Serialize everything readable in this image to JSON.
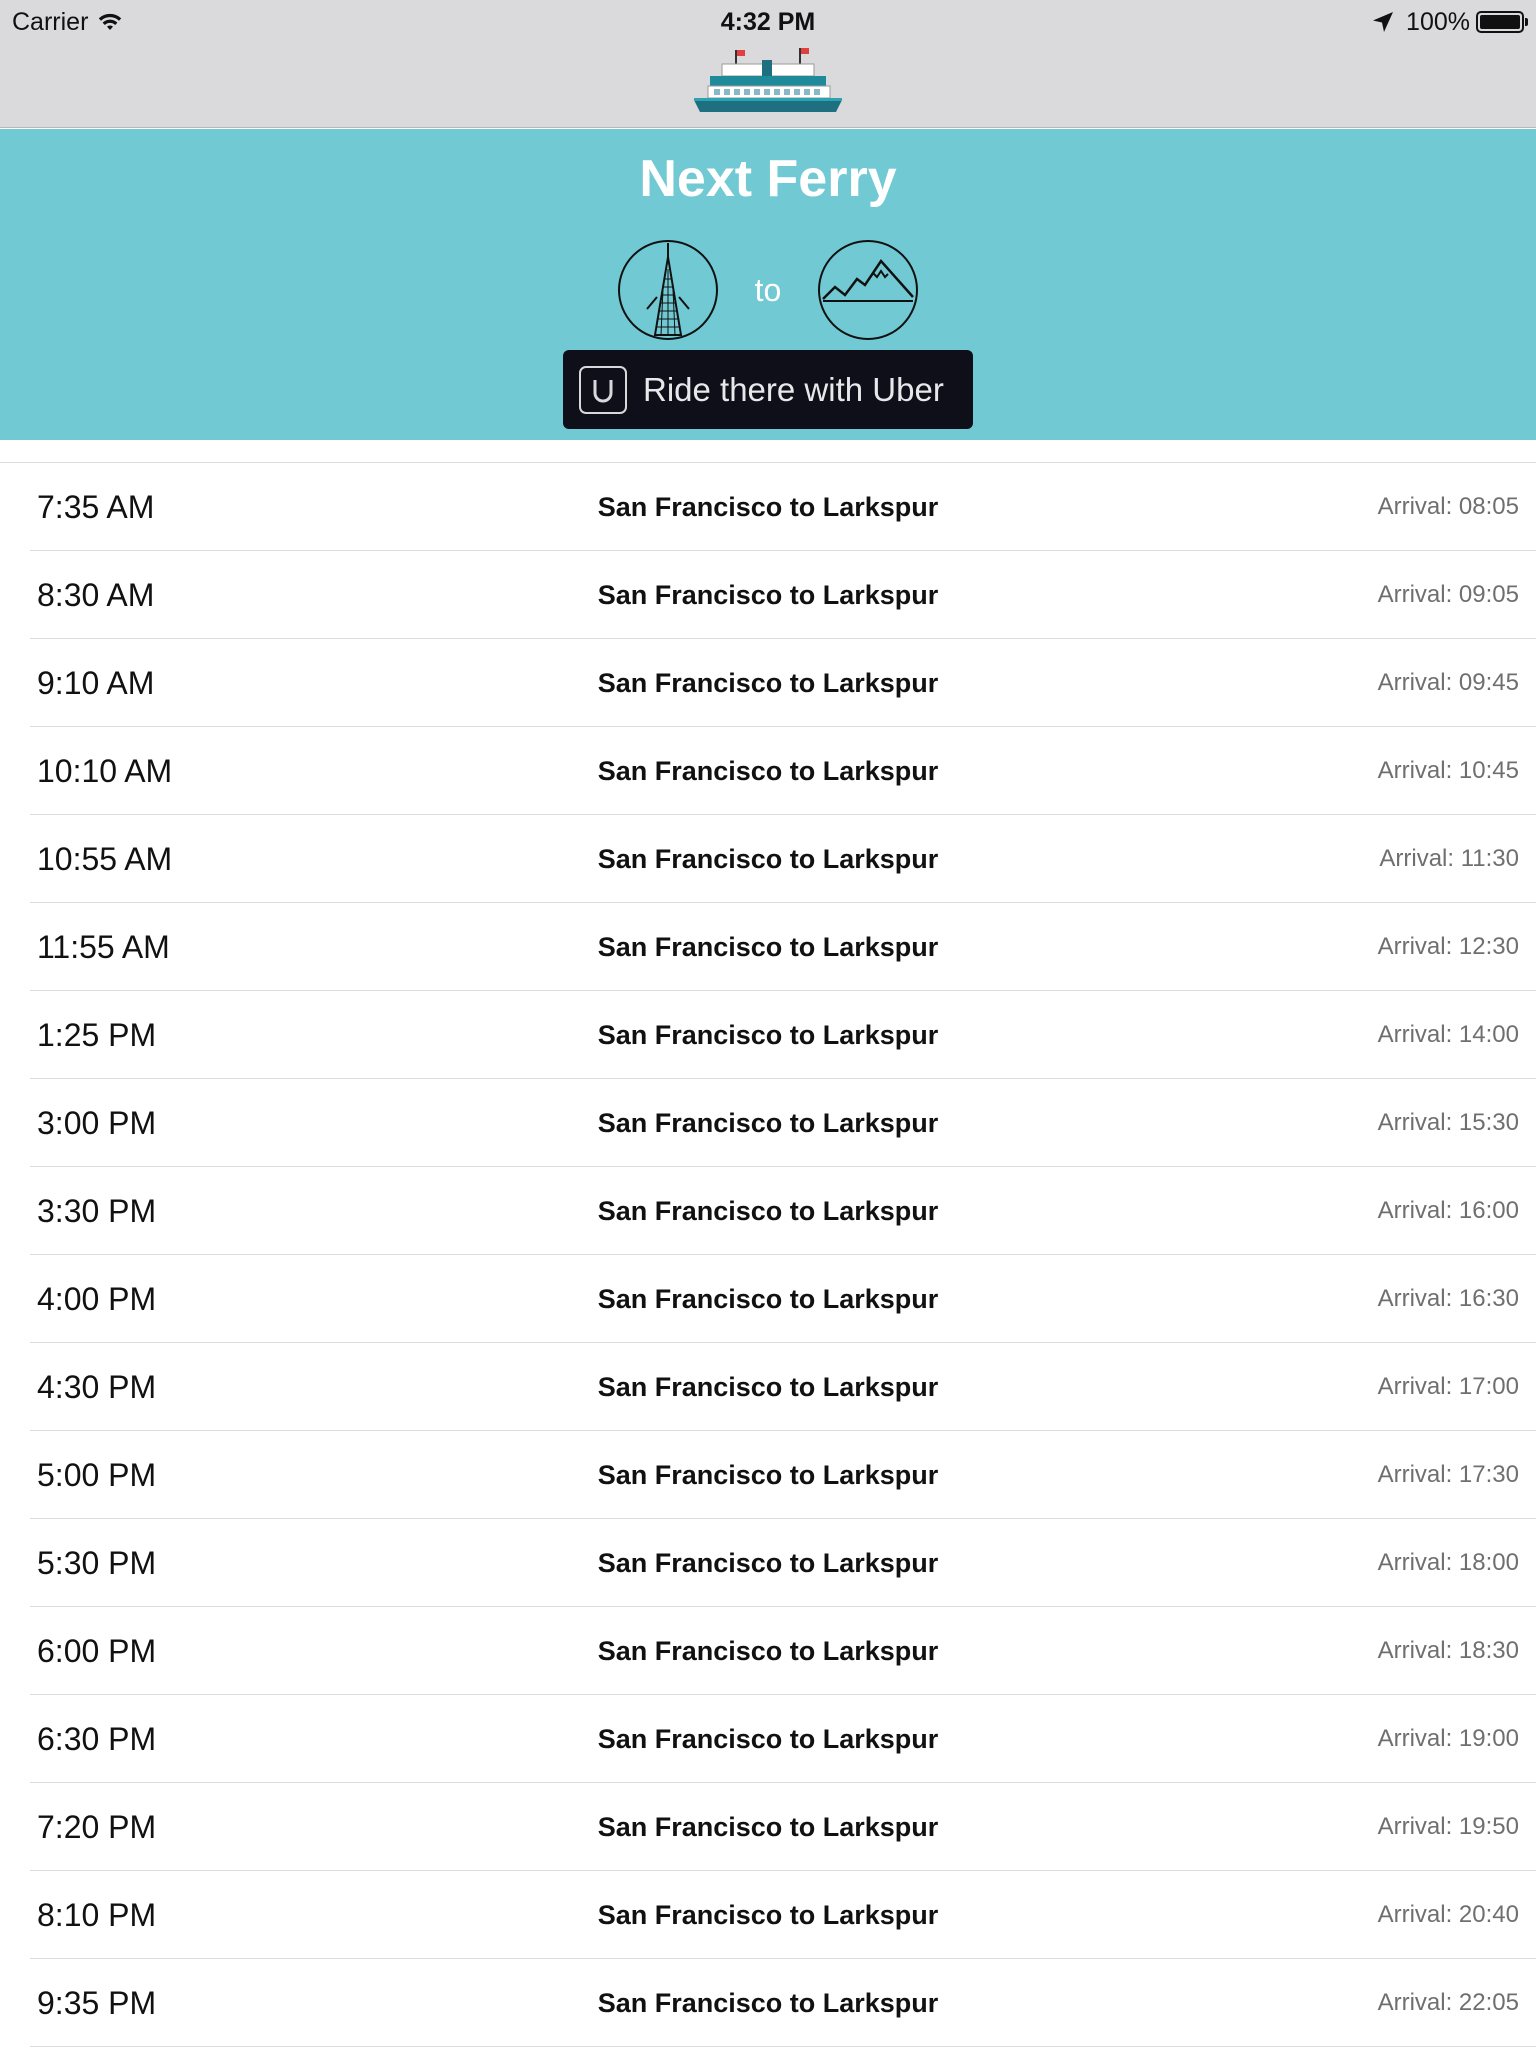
{
  "status_bar": {
    "carrier": "Carrier",
    "time": "4:32 PM",
    "battery": "100%",
    "icons": [
      "wifi-icon",
      "location-arrow-icon",
      "battery-icon"
    ]
  },
  "nav": {
    "logo": "ferry-icon"
  },
  "hero": {
    "title": "Next Ferry",
    "origin_icon": "transamerica-pyramid-icon",
    "connector": "to",
    "destination_icon": "mountain-icon",
    "uber_label": "Ride there with Uber",
    "background_color": "#71c9d3"
  },
  "schedule": [
    {
      "departure": "7:35 AM",
      "route": "San Francisco to Larkspur",
      "arrival": "Arrival: 08:05"
    },
    {
      "departure": "8:30 AM",
      "route": "San Francisco to Larkspur",
      "arrival": "Arrival: 09:05"
    },
    {
      "departure": "9:10 AM",
      "route": "San Francisco to Larkspur",
      "arrival": "Arrival: 09:45"
    },
    {
      "departure": "10:10 AM",
      "route": "San Francisco to Larkspur",
      "arrival": "Arrival: 10:45"
    },
    {
      "departure": "10:55 AM",
      "route": "San Francisco to Larkspur",
      "arrival": "Arrival: 11:30"
    },
    {
      "departure": "11:55 AM",
      "route": "San Francisco to Larkspur",
      "arrival": "Arrival: 12:30"
    },
    {
      "departure": "1:25 PM",
      "route": "San Francisco to Larkspur",
      "arrival": "Arrival: 14:00"
    },
    {
      "departure": "3:00 PM",
      "route": "San Francisco to Larkspur",
      "arrival": "Arrival: 15:30"
    },
    {
      "departure": "3:30 PM",
      "route": "San Francisco to Larkspur",
      "arrival": "Arrival: 16:00"
    },
    {
      "departure": "4:00 PM",
      "route": "San Francisco to Larkspur",
      "arrival": "Arrival: 16:30"
    },
    {
      "departure": "4:30 PM",
      "route": "San Francisco to Larkspur",
      "arrival": "Arrival: 17:00"
    },
    {
      "departure": "5:00 PM",
      "route": "San Francisco to Larkspur",
      "arrival": "Arrival: 17:30"
    },
    {
      "departure": "5:30 PM",
      "route": "San Francisco to Larkspur",
      "arrival": "Arrival: 18:00"
    },
    {
      "departure": "6:00 PM",
      "route": "San Francisco to Larkspur",
      "arrival": "Arrival: 18:30"
    },
    {
      "departure": "6:30 PM",
      "route": "San Francisco to Larkspur",
      "arrival": "Arrival: 19:00"
    },
    {
      "departure": "7:20 PM",
      "route": "San Francisco to Larkspur",
      "arrival": "Arrival: 19:50"
    },
    {
      "departure": "8:10 PM",
      "route": "San Francisco to Larkspur",
      "arrival": "Arrival: 20:40"
    },
    {
      "departure": "9:35 PM",
      "route": "San Francisco to Larkspur",
      "arrival": "Arrival: 22:05"
    }
  ]
}
